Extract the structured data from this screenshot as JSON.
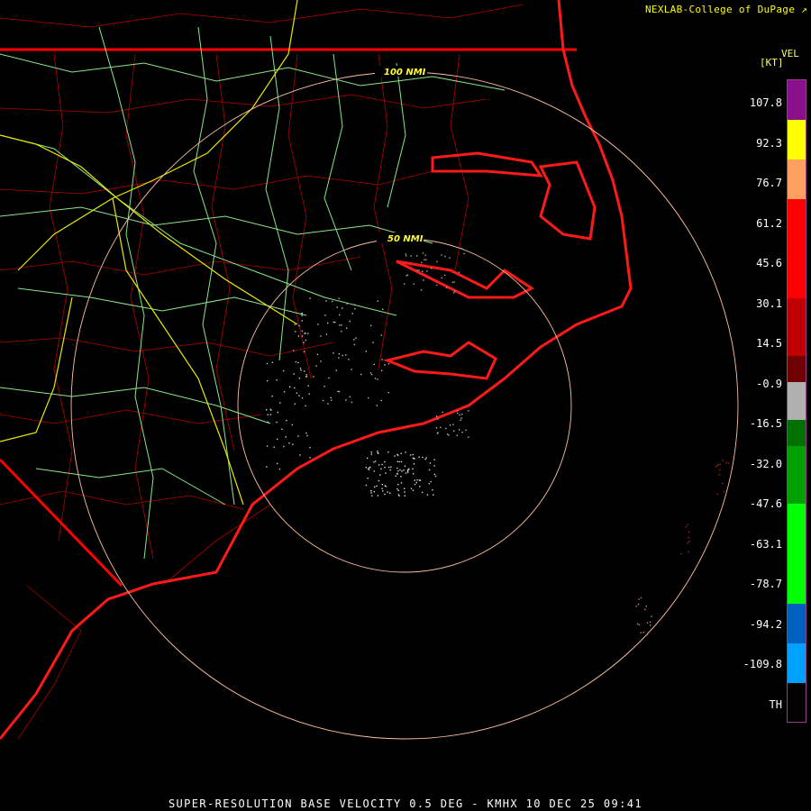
{
  "credit": "NEXLAB-College of DuPage",
  "footer": "SUPER-RESOLUTION BASE VELOCITY 0.5 DEG - KMHX 10 DEC 25 09:41",
  "legend": {
    "title": "VEL",
    "unit": "[KT]",
    "ticks": [
      "107.8",
      "92.3",
      "76.7",
      "61.2",
      "45.6",
      "30.1",
      "14.5",
      "-0.9",
      "-16.5",
      "-32.0",
      "-47.6",
      "-63.1",
      "-78.7",
      "-94.2",
      "-109.8",
      "TH"
    ],
    "bands": [
      {
        "color": "#8a0f8a",
        "from": 0.0,
        "to": 0.062
      },
      {
        "color": "#ffff00",
        "from": 0.062,
        "to": 0.124
      },
      {
        "color": "#ffa060",
        "from": 0.124,
        "to": 0.186
      },
      {
        "color": "#ff0000",
        "from": 0.186,
        "to": 0.34
      },
      {
        "color": "#c00000",
        "from": 0.34,
        "to": 0.43
      },
      {
        "color": "#700000",
        "from": 0.43,
        "to": 0.47
      },
      {
        "color": "#b0b0b0",
        "from": 0.47,
        "to": 0.53
      },
      {
        "color": "#007000",
        "from": 0.53,
        "to": 0.57
      },
      {
        "color": "#00a000",
        "from": 0.57,
        "to": 0.66
      },
      {
        "color": "#00ff00",
        "from": 0.66,
        "to": 0.816
      },
      {
        "color": "#0060c0",
        "from": 0.816,
        "to": 0.878
      },
      {
        "color": "#00a0ff",
        "from": 0.878,
        "to": 0.94
      },
      {
        "color": "#000000",
        "from": 0.94,
        "to": 1.0
      }
    ]
  },
  "rings": [
    {
      "label": "50 NMI"
    },
    {
      "label": "100 NMI"
    }
  ],
  "colors": {
    "state_borders": "#ff0000",
    "county_lines": "#c00000",
    "highways": "#90ee90",
    "interstates": "#ffff00",
    "range_rings": "#ffc0a0"
  }
}
